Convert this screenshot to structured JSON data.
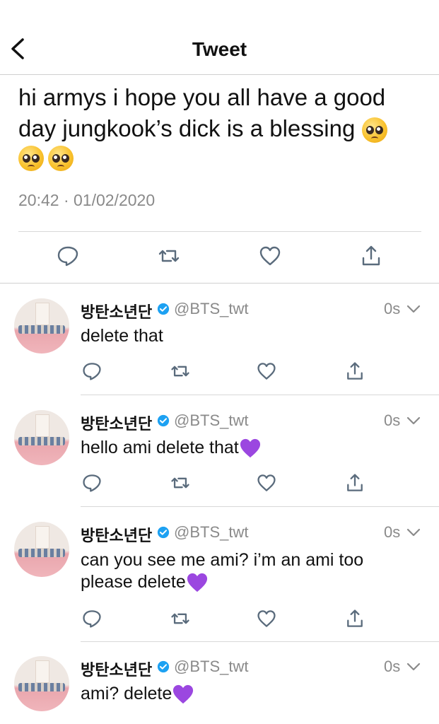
{
  "header": {
    "title": "Tweet"
  },
  "tweet": {
    "text": "hi armys i hope you all have a good day jungkook’s dick is a blessing",
    "timestamp": "20:42 · 01/02/2020"
  },
  "replies": [
    {
      "name": "방탄소년단",
      "handle": "@BTS_twt",
      "time": "0s",
      "text": "delete that"
    },
    {
      "name": "방탄소년단",
      "handle": "@BTS_twt",
      "time": "0s",
      "text": "hello ami delete that"
    },
    {
      "name": "방탄소년단",
      "handle": "@BTS_twt",
      "time": "0s",
      "text": "can you see me ami? i’m an ami too please delete"
    },
    {
      "name": "방탄소년단",
      "handle": "@BTS_twt",
      "time": "0s",
      "text": "ami? delete"
    }
  ],
  "colors": {
    "verified": "#1da1f2",
    "purple_heart": "#9b47e0",
    "text": "#111111",
    "muted": "#8a8a8a"
  },
  "icons": [
    "back-icon",
    "reply-icon",
    "retweet-icon",
    "like-icon",
    "share-icon",
    "verified-icon",
    "chevron-down-icon",
    "purple-heart-icon",
    "pleading-face-icon"
  ]
}
